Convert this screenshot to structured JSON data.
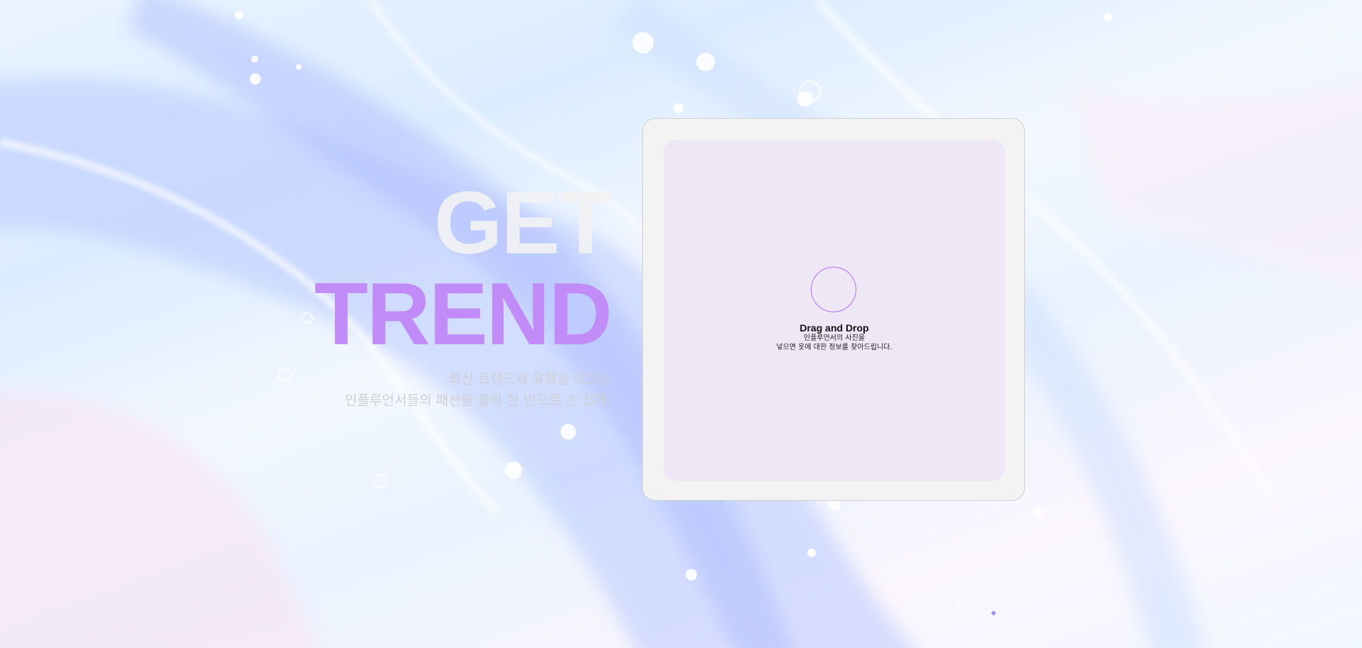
{
  "hero": {
    "line1": "GET",
    "line2": "TREND",
    "subtitle_line1": "최신 트렌드와 유행을 이끄는",
    "subtitle_line2": "인플루언서들의 패션을 클릭 한 번으로 손 쉽게."
  },
  "upload": {
    "title": "Drag and Drop",
    "desc_line1": "인플루언서의 사진을",
    "desc_line2": "넣으면 옷에 대한 정보를 찾아드립니다."
  },
  "colors": {
    "accent": "#c18cf7",
    "dropzone_bg": "#ede7f6",
    "card_bg": "#f3f3f3"
  },
  "icons": {
    "upload": "upload-circle-icon"
  }
}
